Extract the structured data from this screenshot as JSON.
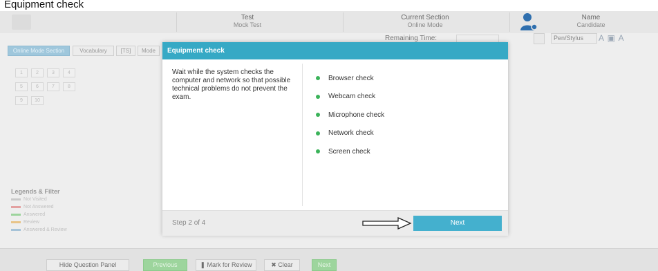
{
  "page": {
    "caption": "Equipment check"
  },
  "header": {
    "test_label": "Test",
    "test_value": "Mock Test",
    "section_label": "Current Section",
    "section_value": "Online Mode",
    "user_label": "Name",
    "user_value": "Candidate",
    "remaining_label": "Remaining Time:"
  },
  "toolbar": {
    "pen_select": "Pen/Stylus",
    "tools": "A ▣ A"
  },
  "tabs": [
    "Online Mode Section",
    "Vocabulary",
    "[TS]",
    "Mode"
  ],
  "question_grid": {
    "row1": [
      "1",
      "2",
      "3",
      "4"
    ],
    "row2": [
      "5",
      "6",
      "7",
      "8"
    ],
    "row3": [
      "9",
      "10"
    ]
  },
  "legend": {
    "title": "Legends & Filter",
    "items": [
      {
        "label": "Not Visited",
        "color": "#c9c9c9"
      },
      {
        "label": "Not Answered",
        "color": "#e3a1a1"
      },
      {
        "label": "Answered",
        "color": "#9dd49d"
      },
      {
        "label": "Review",
        "color": "#e8c488"
      },
      {
        "label": "Answered & Review",
        "color": "#a6c3d8"
      }
    ]
  },
  "bottom_bar": {
    "hide_panel": "Hide Question Panel",
    "previous": "Previous",
    "mark_review": "❚ Mark for Review",
    "clear": "✖ Clear",
    "next": "Next"
  },
  "modal": {
    "title": "Equipment check",
    "description": "Wait while the system checks the computer and network so that possible technical problems do not prevent the exam.",
    "checks": [
      "Browser check",
      "Webcam check",
      "Microphone check",
      "Network check",
      "Screen check"
    ],
    "step": "Step 2 of 4",
    "next_label": "Next"
  },
  "colors": {
    "accent": "#36a9c5",
    "next_button": "#44b0ce",
    "check_dot": "#3bb35a"
  }
}
